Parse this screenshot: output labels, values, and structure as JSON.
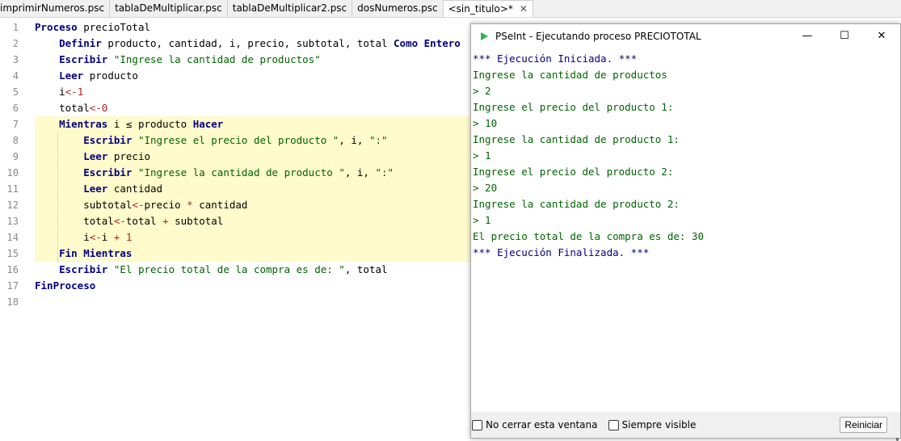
{
  "tabs": [
    {
      "label": "imprimirNumeros.psc"
    },
    {
      "label": "tablaDeMultiplicar.psc"
    },
    {
      "label": "tablaDeMultiplicar2.psc"
    },
    {
      "label": "dosNumeros.psc"
    },
    {
      "label": "<sin_titulo>*",
      "close": "✕"
    }
  ],
  "editor": {
    "line_numbers": [
      "1",
      "2",
      "3",
      "4",
      "5",
      "6",
      "7",
      "8",
      "9",
      "10",
      "11",
      "12",
      "13",
      "14",
      "15",
      "16",
      "17",
      "18"
    ],
    "lines": [
      [
        {
          "t": "Proceso",
          "c": "kw"
        },
        {
          "t": " precioTotal"
        }
      ],
      [
        {
          "t": "    "
        },
        {
          "t": "Definir",
          "c": "kw"
        },
        {
          "t": " producto, cantidad, i, precio, subtotal, total "
        },
        {
          "t": "Como Entero",
          "c": "kw"
        }
      ],
      [
        {
          "t": "    "
        },
        {
          "t": "Escribir",
          "c": "kw"
        },
        {
          "t": " "
        },
        {
          "t": "\"Ingrese la cantidad de productos\"",
          "c": "str"
        }
      ],
      [
        {
          "t": "    "
        },
        {
          "t": "Leer",
          "c": "kw"
        },
        {
          "t": " producto"
        }
      ],
      [
        {
          "t": "    i"
        },
        {
          "t": "<-",
          "c": "op"
        },
        {
          "t": "1",
          "c": "num"
        }
      ],
      [
        {
          "t": "    total"
        },
        {
          "t": "<-",
          "c": "op"
        },
        {
          "t": "0",
          "c": "num"
        }
      ],
      [
        {
          "t": "    "
        },
        {
          "t": "Mientras",
          "c": "kw"
        },
        {
          "t": " i ≤ producto "
        },
        {
          "t": "Hacer",
          "c": "kw"
        }
      ],
      [
        {
          "t": "        "
        },
        {
          "t": "Escribir",
          "c": "kw"
        },
        {
          "t": " "
        },
        {
          "t": "\"Ingrese el precio del producto \"",
          "c": "str"
        },
        {
          "t": ", i, "
        },
        {
          "t": "\":\"",
          "c": "str"
        }
      ],
      [
        {
          "t": "        "
        },
        {
          "t": "Leer",
          "c": "kw"
        },
        {
          "t": " precio"
        }
      ],
      [
        {
          "t": "        "
        },
        {
          "t": "Escribir",
          "c": "kw"
        },
        {
          "t": " "
        },
        {
          "t": "\"Ingrese la cantidad de producto \"",
          "c": "str"
        },
        {
          "t": ", i, "
        },
        {
          "t": "\":\"",
          "c": "str"
        }
      ],
      [
        {
          "t": "        "
        },
        {
          "t": "Leer",
          "c": "kw"
        },
        {
          "t": " cantidad"
        }
      ],
      [
        {
          "t": "        subtotal"
        },
        {
          "t": "<-",
          "c": "op"
        },
        {
          "t": "precio "
        },
        {
          "t": "*",
          "c": "op"
        },
        {
          "t": " cantidad"
        }
      ],
      [
        {
          "t": "        total"
        },
        {
          "t": "<-",
          "c": "op"
        },
        {
          "t": "total "
        },
        {
          "t": "+",
          "c": "op"
        },
        {
          "t": " subtotal"
        }
      ],
      [
        {
          "t": "        i"
        },
        {
          "t": "<-",
          "c": "op"
        },
        {
          "t": "i "
        },
        {
          "t": "+",
          "c": "op"
        },
        {
          "t": " "
        },
        {
          "t": "1",
          "c": "num"
        }
      ],
      [
        {
          "t": "    "
        },
        {
          "t": "Fin Mientras",
          "c": "kw"
        }
      ],
      [
        {
          "t": "    "
        },
        {
          "t": "Escribir",
          "c": "kw"
        },
        {
          "t": " "
        },
        {
          "t": "\"El precio total de la compra es de: \"",
          "c": "str"
        },
        {
          "t": ", total"
        }
      ],
      [
        {
          "t": "FinProceso",
          "c": "kw"
        }
      ],
      []
    ]
  },
  "console": {
    "title": "PSeInt - Ejecutando proceso PRECIOTOTAL",
    "minimize": "—",
    "maximize": "☐",
    "close": "✕",
    "output": [
      {
        "t": "*** Ejecución Iniciada. ***",
        "c": "blue"
      },
      {
        "t": "Ingrese la cantidad de productos",
        "c": "green"
      },
      {
        "t": "> 2",
        "c": "green"
      },
      {
        "t": "Ingrese el precio del producto 1:",
        "c": "green"
      },
      {
        "t": "> 10",
        "c": "green"
      },
      {
        "t": "Ingrese la cantidad de producto 1:",
        "c": "green"
      },
      {
        "t": "> 1",
        "c": "green"
      },
      {
        "t": "Ingrese el precio del producto 2:",
        "c": "green"
      },
      {
        "t": "> 20",
        "c": "green"
      },
      {
        "t": "Ingrese la cantidad de producto 2:",
        "c": "green"
      },
      {
        "t": "> 1",
        "c": "green"
      },
      {
        "t": "El precio total de la compra es de: 30",
        "c": "green"
      },
      {
        "t": "*** Ejecución Finalizada. ***",
        "c": "blue"
      }
    ],
    "no_cerrar_label": "No cerrar esta ventana",
    "siempre_visible_label": "Siempre visible",
    "reiniciar_label": "Reiniciar"
  },
  "colors": {
    "keyword": "#00007f",
    "string": "#006400",
    "number": "#b22222",
    "highlight": "#fffbcc",
    "run_icon": "#2bb24c"
  },
  "icons": {
    "run": "play-icon"
  }
}
